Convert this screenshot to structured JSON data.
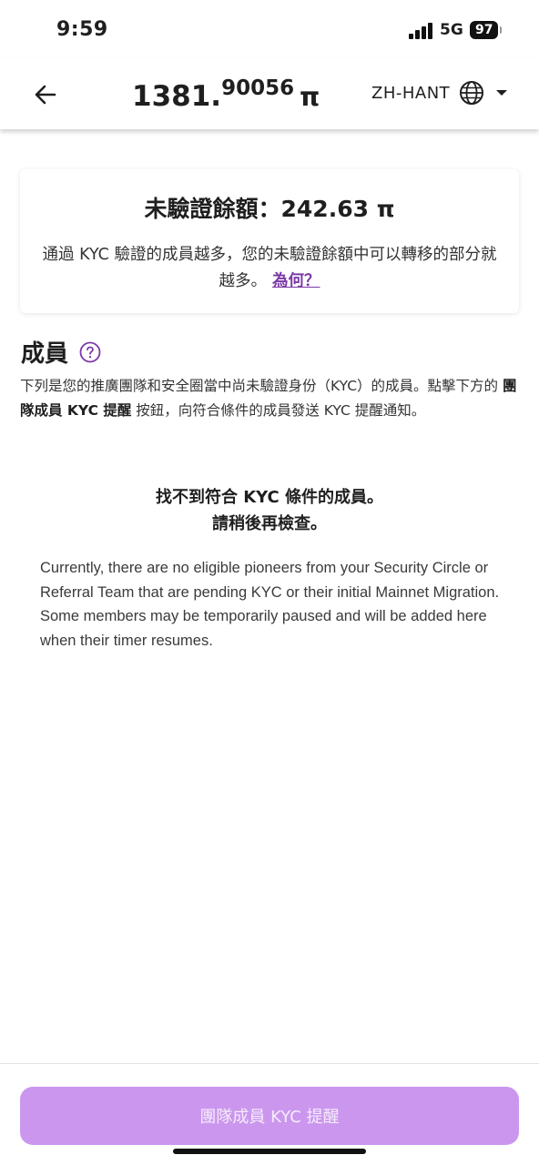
{
  "status_bar": {
    "time": "9:59",
    "network": "5G",
    "battery": "97"
  },
  "header": {
    "balance_integer": "1381.",
    "balance_decimal": "90056",
    "currency_symbol": "π",
    "language": "ZH-HANT"
  },
  "unverified_card": {
    "title": "未驗證餘額：242.63 π",
    "body": "通過 KYC 驗證的成員越多，您的未驗證餘額中可以轉移的部分就越多。",
    "why_link": "為何？"
  },
  "members": {
    "title": "成員",
    "desc_part1": "下列是您的推廣團隊和安全圈當中尚未驗證身份（KYC）的成員。點擊下方的",
    "desc_bold": "團隊成員 KYC 提醒",
    "desc_part2": "按鈕，向符合條件的成員發送 KYC 提醒通知。"
  },
  "empty_state": {
    "line1": "找不到符合 KYC 條件的成員。",
    "line2": "請稍後再檢查。",
    "description": "Currently, there are no eligible pioneers from your Security Circle or Referral Team that are pending KYC or their initial Mainnet Migration. Some members may be temporarily paused and will be added here when their timer resumes."
  },
  "footer": {
    "button_label": "團隊成員 KYC 提醒"
  },
  "colors": {
    "accent": "#7b3aa6",
    "button_disabled": "#cb97ee"
  },
  "icons": [
    "signal-icon",
    "back-arrow-icon",
    "globe-icon",
    "caret-down-icon",
    "help-icon"
  ]
}
